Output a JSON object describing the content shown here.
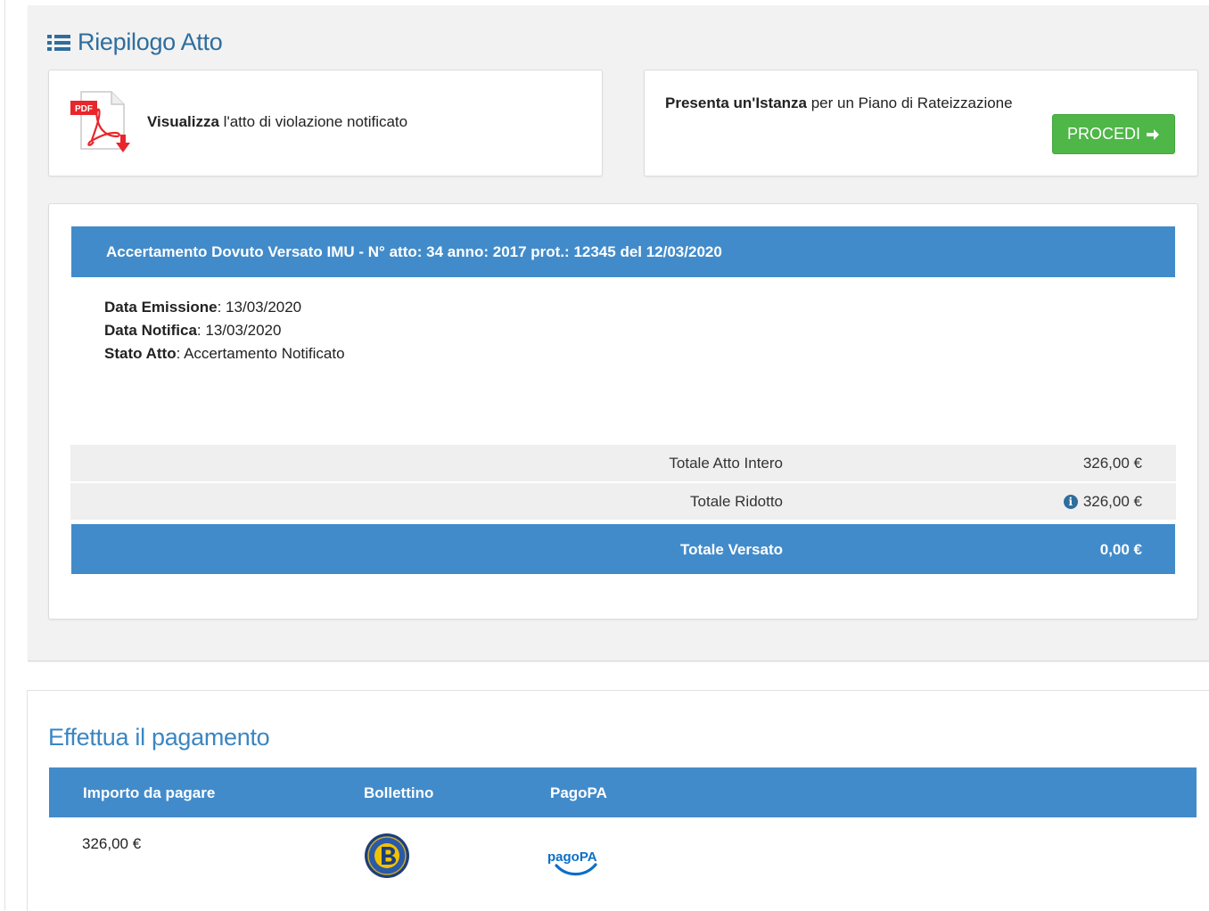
{
  "header": {
    "title": "Riepilogo Atto",
    "icon": "list-icon"
  },
  "pdf_card": {
    "icon": "pdf-download-icon",
    "bold": "Visualizza",
    "text": " l'atto di violazione notificato"
  },
  "istanza_card": {
    "bold": "Presenta un'Istanza",
    "text": " per un Piano di Rateizzazione",
    "button_label": "PROCEDI",
    "button_color": "#4fb648"
  },
  "atto": {
    "header": "Accertamento Dovuto Versato IMU - N° atto: 34 anno: 2017 prot.: 12345 del 12/03/2020",
    "details": [
      {
        "label": "Data Emissione",
        "value": ": 13/03/2020"
      },
      {
        "label": "Data Notifica",
        "value": ": 13/03/2020"
      },
      {
        "label": "Stato Atto",
        "value": ": Accertamento Notificato"
      }
    ],
    "totals": [
      {
        "label": "Totale Atto Intero",
        "value": "326,00 €"
      },
      {
        "label": "Totale Ridotto",
        "value": "326,00 €"
      },
      {
        "label": "Totale Versato",
        "value": "0,00 €"
      }
    ]
  },
  "payment": {
    "title": "Effettua il pagamento",
    "columns": [
      "Importo da pagare",
      "Bollettino",
      "PagoPA"
    ],
    "row": {
      "amount": "326,00 €",
      "bollettino_icon": "bollettino-logo-icon",
      "pagopa_icon": "pagopa-logo-icon"
    }
  },
  "colors": {
    "primary": "#428bca",
    "title": "#2e6e9e",
    "success": "#4fb648"
  }
}
